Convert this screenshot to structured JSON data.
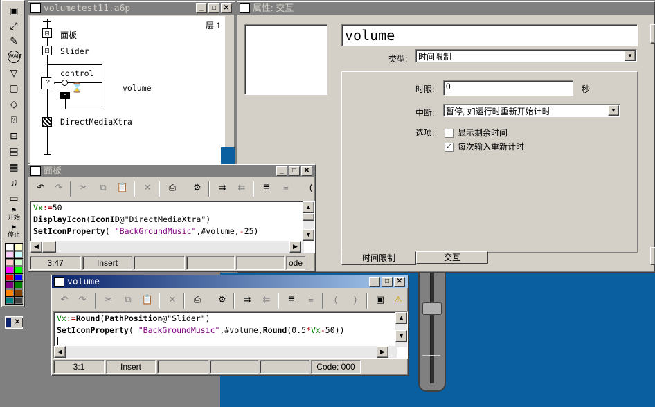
{
  "flow_window": {
    "title": "volumetest11.a6p",
    "level_label": "层 1",
    "icons": [
      {
        "label": "面板",
        "icon": "calc-icon"
      },
      {
        "label": "Slider",
        "icon": "calc-icon"
      },
      {
        "label": "control",
        "icon": "interaction-icon"
      },
      {
        "label": "volume",
        "icon": "response-icon"
      },
      {
        "label": "DirectMediaXtra",
        "icon": "sprite-icon"
      }
    ]
  },
  "tool_palette": {
    "start_label": "开始",
    "stop_label": "停止",
    "colors": [
      "#ffffff",
      "#ffffcc",
      "#ffccff",
      "#ccffff",
      "#ffcccc",
      "#ccffcc",
      "#ff00ff",
      "#00ff00",
      "#ff0000",
      "#0000ff",
      "#800080",
      "#008000",
      "#ff8000",
      "#804000",
      "#008080",
      "#404040"
    ]
  },
  "props_window": {
    "title": "属性: 交互",
    "icon_name": "volume",
    "type_label": "类型:",
    "type_value": "时间限制",
    "time_limit_label": "时限:",
    "time_limit_value": "0",
    "time_unit": "秒",
    "interrupt_label": "中断:",
    "interrupt_value": "暂停, 如运行时重新开始计时",
    "options_label": "选项:",
    "options": [
      {
        "label": "显示剩余时间",
        "checked": false
      },
      {
        "label": "每次输入重新计时",
        "checked": true
      }
    ],
    "tabs": [
      "时间限制",
      "交互"
    ]
  },
  "panel_calc": {
    "title": "面板",
    "lines": [
      [
        {
          "t": "Vx",
          "c": "gv"
        },
        {
          "t": ":=",
          "c": "ca"
        },
        {
          "t": "50",
          "c": ""
        }
      ],
      [
        {
          "t": "DisplayIcon",
          "c": "kw"
        },
        {
          "t": "(",
          "c": ""
        },
        {
          "t": "IconID",
          "c": "kw"
        },
        {
          "t": "@\"DirectMediaXtra\")",
          "c": ""
        }
      ],
      [
        {
          "t": "SetIconProperty",
          "c": "kw"
        },
        {
          "t": "( ",
          "c": ""
        },
        {
          "t": "\"BackGroundMusic\"",
          "c": "str"
        },
        {
          "t": ",#volume,",
          "c": ""
        },
        {
          "t": "-",
          "c": "ca"
        },
        {
          "t": "25)",
          "c": ""
        }
      ]
    ],
    "status": [
      "3:47",
      "Insert",
      "",
      "",
      "ode"
    ]
  },
  "volume_calc": {
    "title": "volume",
    "lines": [
      [
        {
          "t": "Vx",
          "c": "gv"
        },
        {
          "t": ":=",
          "c": "ca"
        },
        {
          "t": "Round",
          "c": "kw"
        },
        {
          "t": "(",
          "c": ""
        },
        {
          "t": "PathPosition",
          "c": "kw"
        },
        {
          "t": "@\"Slider\")",
          "c": ""
        }
      ],
      [
        {
          "t": "SetIconProperty",
          "c": "kw"
        },
        {
          "t": "( ",
          "c": ""
        },
        {
          "t": "\"BackGroundMusic\"",
          "c": "str"
        },
        {
          "t": ",#volume,",
          "c": ""
        },
        {
          "t": "Round",
          "c": "kw"
        },
        {
          "t": "(0.5",
          "c": ""
        },
        {
          "t": "*",
          "c": "ca"
        },
        {
          "t": "Vx",
          "c": "gv"
        },
        {
          "t": "-",
          "c": "ca"
        },
        {
          "t": "50))",
          "c": ""
        }
      ]
    ],
    "status": [
      "3:1",
      "Insert",
      "",
      "",
      "Code: 000"
    ]
  },
  "mini_window": {
    "close_label": "✕"
  }
}
